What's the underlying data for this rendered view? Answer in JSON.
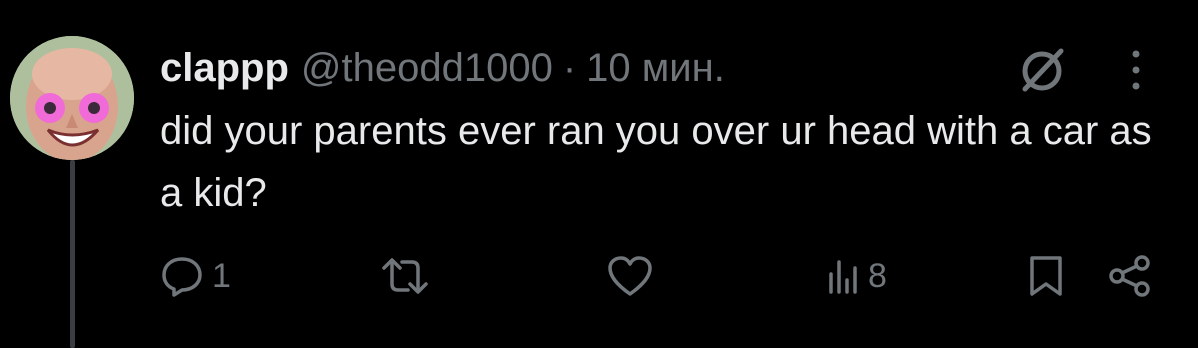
{
  "tweet": {
    "display_name": "clappp",
    "handle": "@theodd1000",
    "separator": "·",
    "time": "10 мин.",
    "text": "did your parents ever ran you over ur head with a car as a kid?",
    "avatar_icon": "avatar-face-photo",
    "actions": {
      "reply": {
        "icon": "reply-bubble-icon",
        "count": "1"
      },
      "retweet": {
        "icon": "retweet-arrows-icon",
        "count": ""
      },
      "like": {
        "icon": "heart-icon",
        "count": ""
      },
      "views": {
        "icon": "views-bars-icon",
        "count": "8"
      },
      "bookmark": {
        "icon": "bookmark-icon"
      },
      "share": {
        "icon": "share-nodes-icon"
      }
    }
  },
  "colors": {
    "background": "#000000",
    "primary_text": "#e7e9ea",
    "secondary_text": "#71767b",
    "thread_line": "#3a3d41"
  }
}
